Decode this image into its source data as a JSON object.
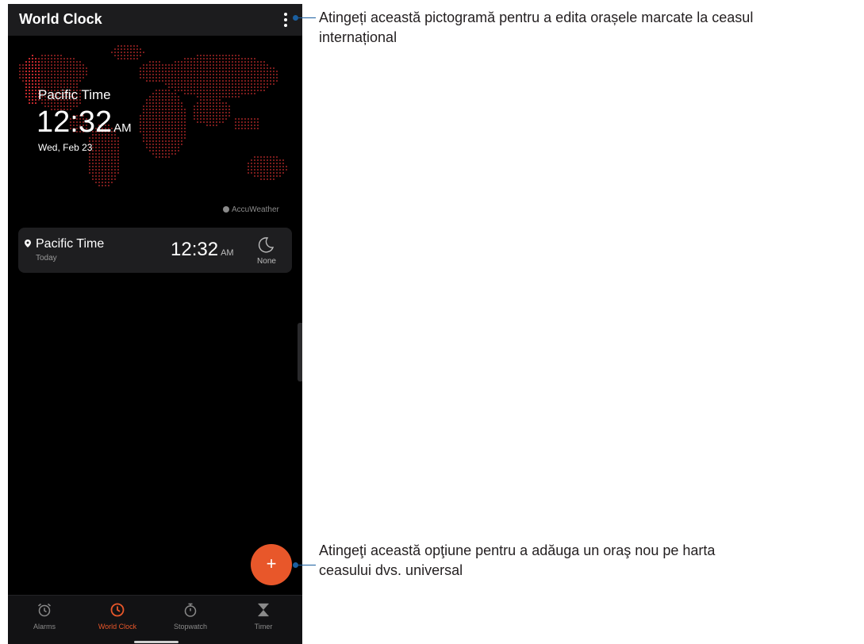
{
  "app_bar": {
    "title": "World Clock",
    "menu_icon": "more-vert-icon"
  },
  "map": {
    "zone_name": "Pacific Time",
    "time": "12:32",
    "ampm": "AM",
    "date": "Wed, Feb 23",
    "attribution": "AccuWeather",
    "dot_color": "#7a1c1c",
    "highlight_color": "#c0282c"
  },
  "city_card": {
    "name": "Pacific Time",
    "day": "Today",
    "time": "12:32",
    "ampm": "AM",
    "weather_icon": "moon-icon",
    "weather_label": "None"
  },
  "fab": {
    "label": "+",
    "color": "#e8572a"
  },
  "bottom_nav": {
    "items": [
      {
        "label": "Alarms",
        "icon": "alarm-icon",
        "active": false
      },
      {
        "label": "World Clock",
        "icon": "clock-icon",
        "active": true
      },
      {
        "label": "Stopwatch",
        "icon": "stopwatch-icon",
        "active": false
      },
      {
        "label": "Timer",
        "icon": "hourglass-icon",
        "active": false
      }
    ],
    "active_color": "#e8572a",
    "inactive_color": "#8a8a8a"
  },
  "callouts": {
    "menu": {
      "line1": "Atingeți această pictogramă pentru a edita orașele marcate la ceasul",
      "line2": "internațional"
    },
    "add": {
      "line1": "Atingeţi această opţiune pentru a adăuga un oraş nou pe harta",
      "line2": "ceasului dvs. universal"
    },
    "accent_color": "#1a5fa0"
  }
}
